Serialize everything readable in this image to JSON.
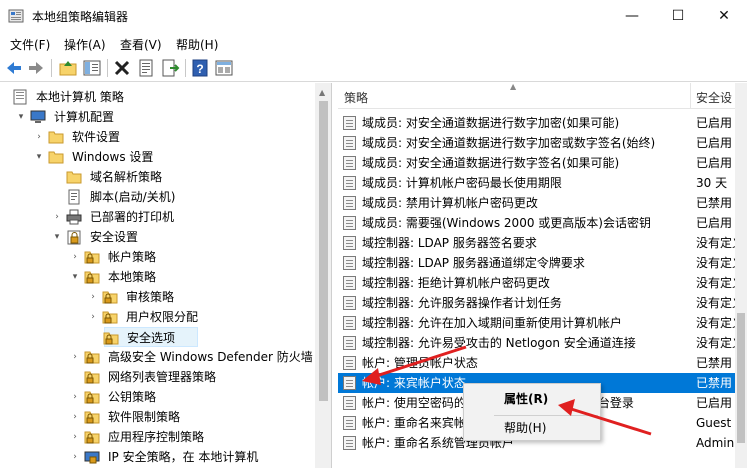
{
  "window": {
    "title": "本地组策略编辑器",
    "controls": {
      "minimize": "—",
      "maximize": "☐",
      "close": "✕"
    }
  },
  "menu": [
    "文件(F)",
    "操作(A)",
    "查看(V)",
    "帮助(H)"
  ],
  "toolbar": [
    "back-icon",
    "forward-icon",
    "up-folder-icon",
    "show-tree-icon",
    "delete-icon",
    "properties-icon",
    "export-icon",
    "help-icon",
    "view-icon"
  ],
  "tree": [
    {
      "label": "本地计算机 策略",
      "indent": 0,
      "expander": "",
      "icon": "computer-policy-icon"
    },
    {
      "label": "计算机配置",
      "indent": 1,
      "expander": "▾",
      "icon": "computer-icon"
    },
    {
      "label": "软件设置",
      "indent": 2,
      "expander": "›",
      "icon": "folder-icon"
    },
    {
      "label": "Windows 设置",
      "indent": 2,
      "expander": "▾",
      "icon": "folder-icon"
    },
    {
      "label": "域名解析策略",
      "indent": 3,
      "expander": "",
      "icon": "folder-icon"
    },
    {
      "label": "脚本(启动/关机)",
      "indent": 3,
      "expander": "",
      "icon": "script-icon"
    },
    {
      "label": "已部署的打印机",
      "indent": 3,
      "expander": "›",
      "icon": "printer-icon"
    },
    {
      "label": "安全设置",
      "indent": 3,
      "expander": "▾",
      "icon": "security-icon"
    },
    {
      "label": "帐户策略",
      "indent": 4,
      "expander": "›",
      "icon": "lock-folder-icon"
    },
    {
      "label": "本地策略",
      "indent": 4,
      "expander": "▾",
      "icon": "lock-folder-icon"
    },
    {
      "label": "审核策略",
      "indent": 5,
      "expander": "›",
      "icon": "lock-folder-icon"
    },
    {
      "label": "用户权限分配",
      "indent": 5,
      "expander": "›",
      "icon": "lock-folder-icon"
    },
    {
      "label": "安全选项",
      "indent": 5,
      "expander": "",
      "icon": "lock-folder-icon",
      "selected": true
    },
    {
      "label": "高级安全 Windows Defender 防火墙",
      "indent": 4,
      "expander": "›",
      "icon": "lock-folder-icon"
    },
    {
      "label": "网络列表管理器策略",
      "indent": 4,
      "expander": "",
      "icon": "lock-folder-icon"
    },
    {
      "label": "公钥策略",
      "indent": 4,
      "expander": "›",
      "icon": "lock-folder-icon"
    },
    {
      "label": "软件限制策略",
      "indent": 4,
      "expander": "›",
      "icon": "lock-folder-icon"
    },
    {
      "label": "应用程序控制策略",
      "indent": 4,
      "expander": "›",
      "icon": "lock-folder-icon"
    },
    {
      "label": "IP 安全策略，在 本地计算机",
      "indent": 4,
      "expander": "›",
      "icon": "ip-security-icon"
    }
  ],
  "columns": {
    "policy": "策略",
    "setting": "安全设"
  },
  "policies": [
    {
      "name": "域成员: 对安全通道数据进行数字加密(如果可能)",
      "value": "已启用"
    },
    {
      "name": "域成员: 对安全通道数据进行数字加密或数字签名(始终)",
      "value": "已启用"
    },
    {
      "name": "域成员: 对安全通道数据进行数字签名(如果可能)",
      "value": "已启用"
    },
    {
      "name": "域成员: 计算机帐户密码最长使用期限",
      "value": "30 天"
    },
    {
      "name": "域成员: 禁用计算机帐户密码更改",
      "value": "已禁用"
    },
    {
      "name": "域成员: 需要强(Windows 2000 或更高版本)会话密钥",
      "value": "已启用"
    },
    {
      "name": "域控制器: LDAP 服务器签名要求",
      "value": "没有定义"
    },
    {
      "name": "域控制器: LDAP 服务器通道绑定令牌要求",
      "value": "没有定义"
    },
    {
      "name": "域控制器: 拒绝计算机帐户密码更改",
      "value": "没有定义"
    },
    {
      "name": "域控制器: 允许服务器操作者计划任务",
      "value": "没有定义"
    },
    {
      "name": "域控制器:  允许在加入域期间重新使用计算机帐户",
      "value": "没有定义"
    },
    {
      "name": "域控制器: 允许易受攻击的 Netlogon 安全通道连接",
      "value": "没有定义"
    },
    {
      "name": "帐户: 管理员帐户状态",
      "value": "已禁用"
    },
    {
      "name": "帐户: 来宾帐户状态",
      "value": "已禁用",
      "selected": true
    },
    {
      "name": "帐户: 使用空密码的本地帐户只允许进行控制台登录",
      "value": "已启用"
    },
    {
      "name": "帐户: 重命名来宾帐户",
      "value": "Guest"
    },
    {
      "name": "帐户: 重命名系统管理员帐户",
      "value": "Admini"
    }
  ],
  "context_menu": {
    "properties": "属性(R)",
    "help": "帮助(H)"
  },
  "colors": {
    "selection": "#0078d7",
    "arrow": "#e02020",
    "tree_selected": "#e5f3fb"
  }
}
